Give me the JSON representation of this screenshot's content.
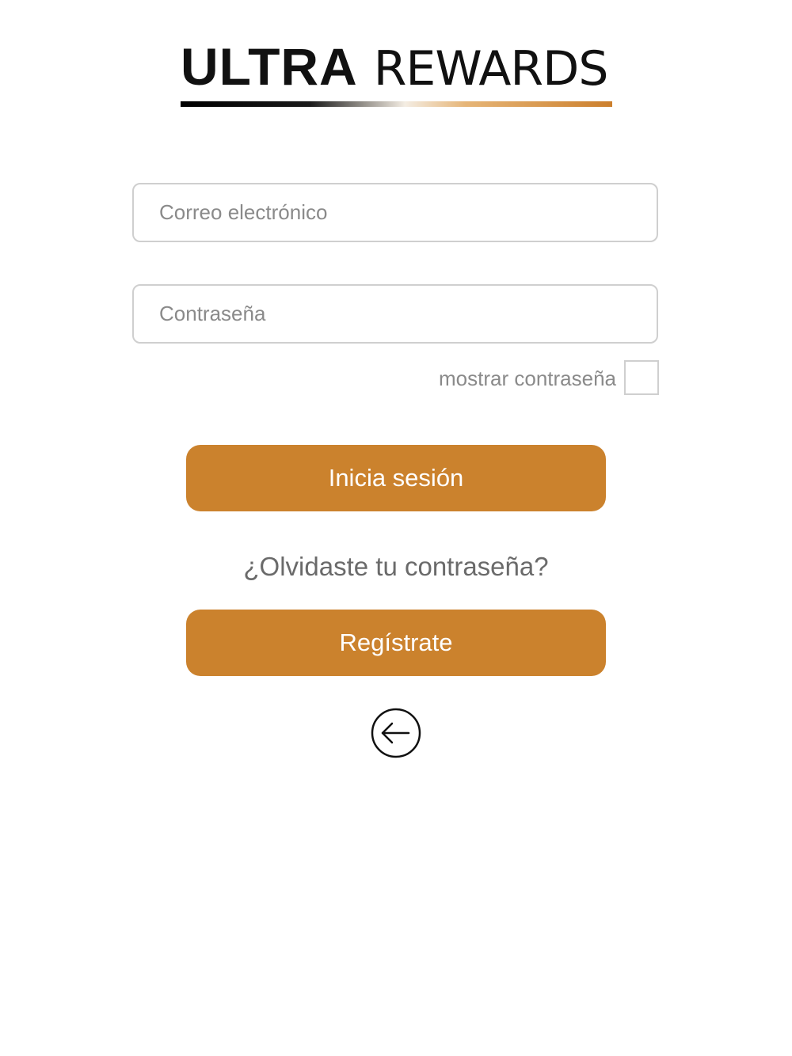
{
  "logo": {
    "brand_bold": "ULTRA",
    "brand_light": "REWARDS"
  },
  "form": {
    "email_placeholder": "Correo electrónico",
    "email_value": "",
    "password_placeholder": "Contraseña",
    "password_value": "",
    "show_password_label": "mostrar contraseña",
    "show_password_checked": false
  },
  "actions": {
    "login_label": "Inicia sesión",
    "forgot_password_label": "¿Olvidaste tu contraseña?",
    "register_label": "Regístrate",
    "back_icon": "arrow-left-circle-icon"
  },
  "colors": {
    "accent": "#cb822d",
    "text_muted": "#8a8a8a",
    "border": "#cfcfcf"
  }
}
